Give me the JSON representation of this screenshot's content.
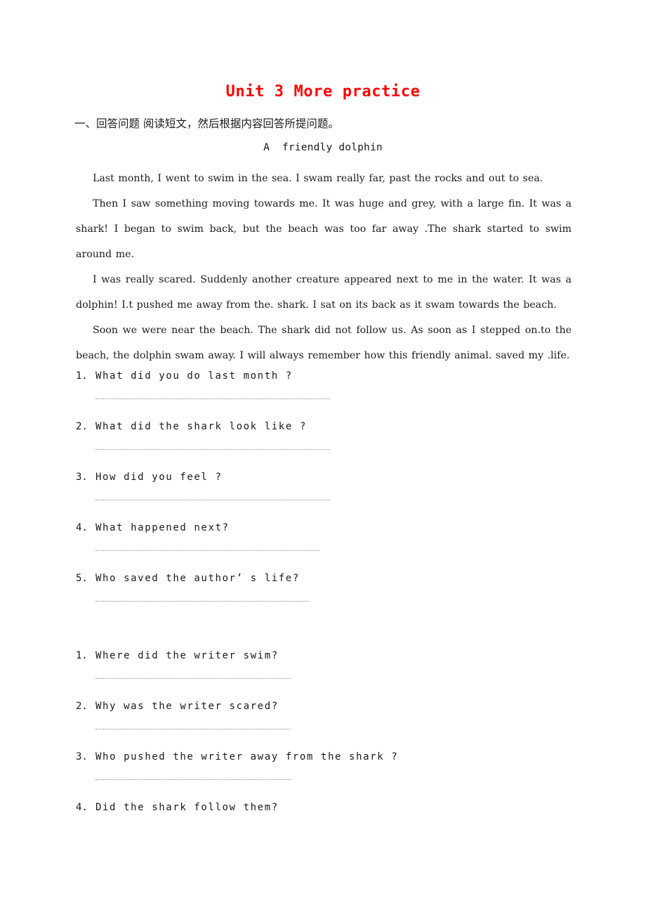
{
  "document": {
    "title": "Unit 3 More practice",
    "title_color": "#ff0000",
    "instruction": "一、回答问题 阅读短文，然后根据内容回答所提问题。",
    "passage_heading": "A  friendly dolphin",
    "paragraphs": [
      "Last month, I went to swim in the sea. I swam really far, past the rocks and out to sea.",
      "Then I saw something moving towards me. It was huge and grey, with a large fin. It was a shark! I began to swim back, but the beach was too far away .The shark started to swim around me.",
      "I was really scared. Suddenly another creature appeared next to me in the water. It was a dolphin! I.t pushed me away from the. shark. I sat on its back as it swam towards the beach.",
      "Soon we were near the beach. The shark did not follow us. As soon as I stepped on.to the beach, the dolphin swam away. I will always remember how this friendly animal. saved my .life."
    ],
    "question_set_1": [
      {
        "number": "1.",
        "text": "What did you do last month ?",
        "line_width": 334
      },
      {
        "number": "2.",
        "text": "What did the shark look like ?",
        "line_width": 334
      },
      {
        "number": "3.",
        "text": "How did you feel ?",
        "line_width": 334
      },
      {
        "number": "4.",
        "text": "What happened next?",
        "line_width": 318
      },
      {
        "number": "5.",
        "text": "Who saved the author’ s life?",
        "line_width": 304
      }
    ],
    "question_set_2": [
      {
        "number": "1.",
        "text": "Where did the writer swim?",
        "line_width": 278
      },
      {
        "number": "2.",
        "text": "Why was the writer scared?",
        "line_width": 278
      },
      {
        "number": "3.",
        "text": "Who pushed the writer away from the shark ?",
        "line_width": 278
      },
      {
        "number": "4.",
        "text": "Did the shark follow them?",
        "line_width": 0
      }
    ]
  }
}
